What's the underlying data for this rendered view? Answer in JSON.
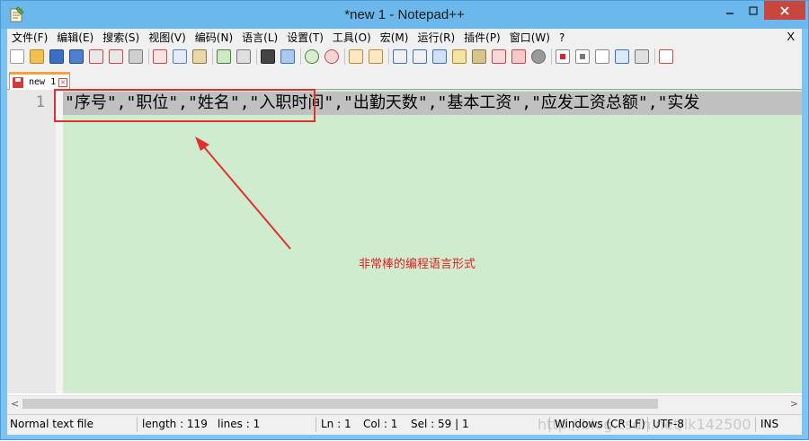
{
  "window": {
    "title": "*new 1 - Notepad++"
  },
  "menu": {
    "items": [
      "文件(F)",
      "编辑(E)",
      "搜索(S)",
      "视图(V)",
      "编码(N)",
      "语言(L)",
      "设置(T)",
      "工具(O)",
      "宏(M)",
      "运行(R)",
      "插件(P)",
      "窗口(W)",
      "?"
    ],
    "close_label": "X"
  },
  "toolbar": {
    "icons": [
      "new-file-icon",
      "open-file-icon",
      "save-icon",
      "save-all-icon",
      "close-icon",
      "close-all-icon",
      "print-icon",
      "cut-icon",
      "copy-icon",
      "paste-icon",
      "undo-icon",
      "redo-icon",
      "find-icon",
      "replace-icon",
      "zoom-in-icon",
      "zoom-out-icon",
      "sync-v-icon",
      "sync-h-icon",
      "word-wrap-icon",
      "show-all-chars-icon",
      "indent-guide-icon",
      "udl-icon",
      "doc-map-icon",
      "function-list-icon",
      "folder-workspace-icon",
      "monitoring-icon",
      "record-macro-icon",
      "stop-macro-icon",
      "play-macro-icon",
      "run-macro-multi-icon",
      "save-macro-icon",
      "spell-check-icon"
    ]
  },
  "tab": {
    "label": "new 1",
    "close_glyph": "×"
  },
  "editor": {
    "line_number": "1",
    "line_text": "\"序号\",\"职位\",\"姓名\",\"入职时间\",\"出勤天数\",\"基本工资\",\"应发工资总额\",\"实发",
    "annotation": "非常棒的编程语言形式"
  },
  "scrollbar": {
    "left_glyph": "<",
    "right_glyph": ">"
  },
  "status": {
    "file_type": "Normal text file",
    "length": "length : 119",
    "lines": "lines : 1",
    "ln": "Ln : 1",
    "col": "Col : 1",
    "sel": "Sel : 59 | 1",
    "eol": "Windows (CR LF)",
    "encoding": "UTF-8",
    "mode": "INS",
    "watermark": "http://blog.csdn.net/lk142500"
  },
  "colors": {
    "titlebar": "#6cb8ec",
    "close_button": "#c7463d",
    "editor_bg": "#cfeccf",
    "line_highlight": "#c0c0c0",
    "annotation": "#e02020",
    "tab_accent": "#f7a13b"
  }
}
